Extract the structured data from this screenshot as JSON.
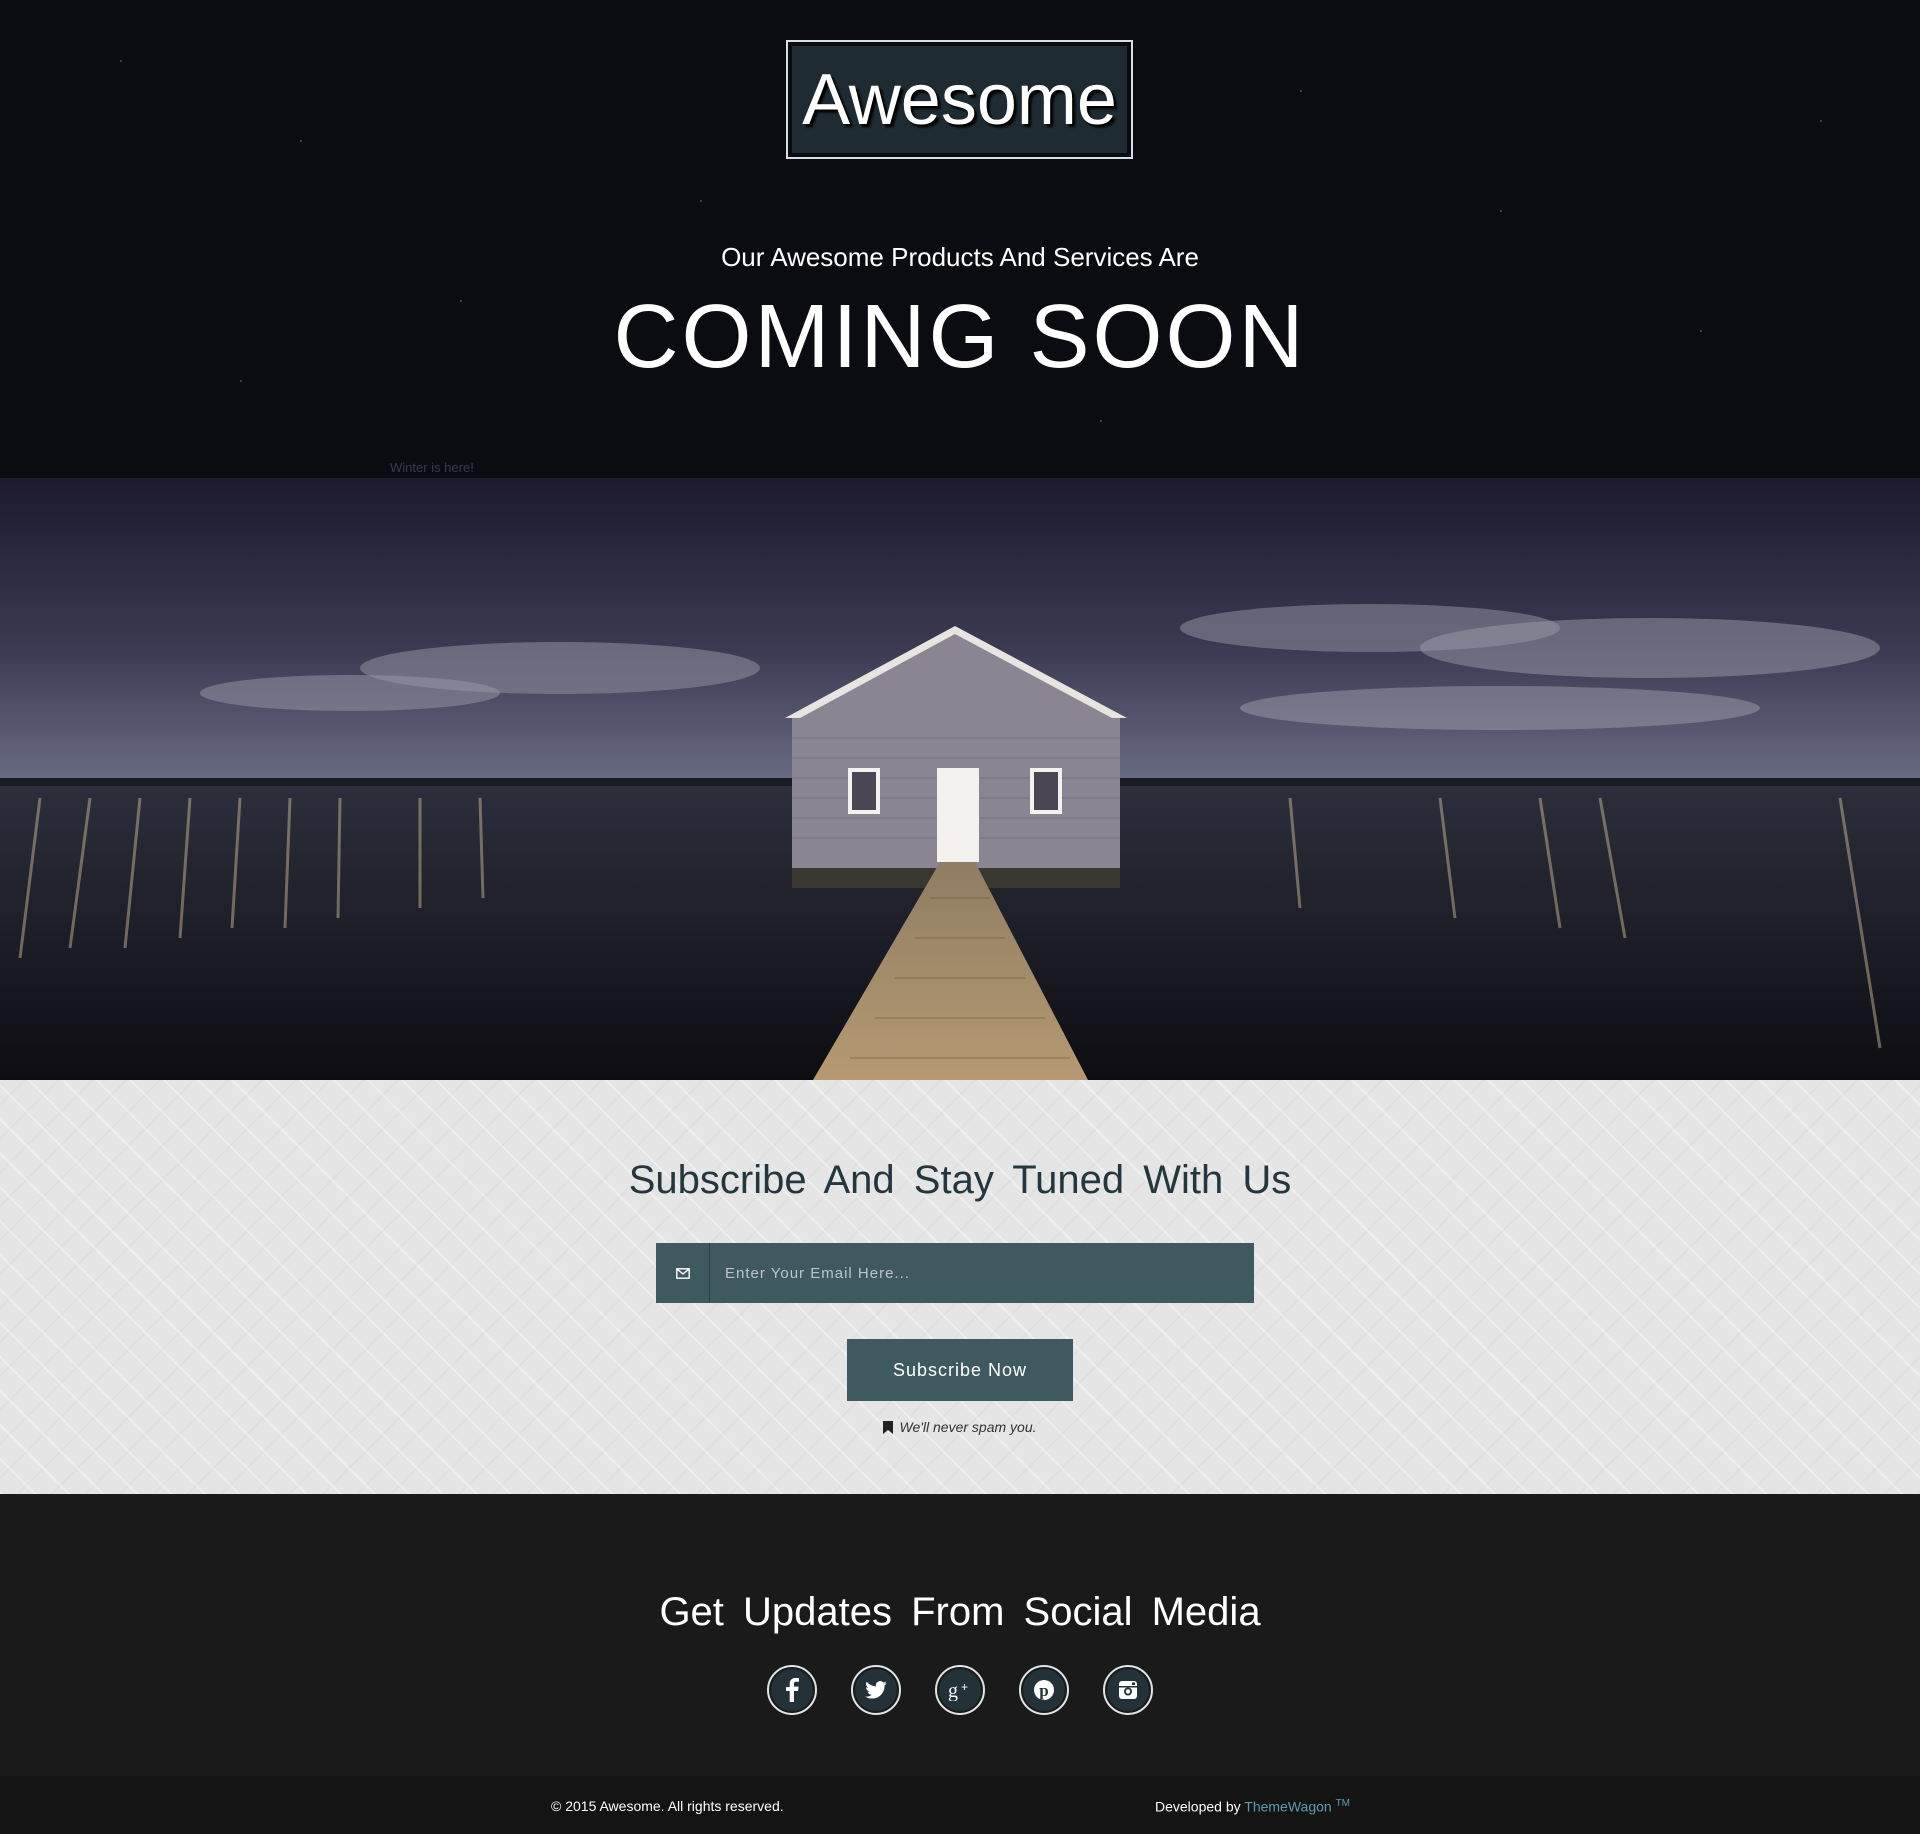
{
  "hero": {
    "logo_text": "Awesome",
    "tagline": "Our Awesome Products And Services Are",
    "headline": "COMING SOON",
    "image_caption": "Winter is here!"
  },
  "subscribe": {
    "title": "Subscribe And Stay Tuned With Us",
    "email_icon": "envelope-icon",
    "email_placeholder": "Enter Your Email Here...",
    "button_label": "Subscribe Now",
    "spam_icon": "bookmark-icon",
    "spam_note": "We'll never spam you."
  },
  "social": {
    "title": "Get Updates From Social Media",
    "icons": [
      "facebook-icon",
      "twitter-icon",
      "google-plus-icon",
      "pinterest-icon",
      "instagram-icon"
    ]
  },
  "footer": {
    "copyright": "© 2015 Awesome. All rights reserved.",
    "developed_prefix": "Developed by",
    "developer_link": "ThemeWagon",
    "trademark": "TM"
  },
  "colors": {
    "hero_bg": "#0b0b12",
    "logo_bg": "#1e2b32",
    "accent": "#3f5960",
    "subscribe_bg": "#e5e5e5",
    "title_text": "#24373f",
    "social_bg": "#1a1a1a",
    "footer_bg": "#141414",
    "link": "#5a9cb0"
  }
}
